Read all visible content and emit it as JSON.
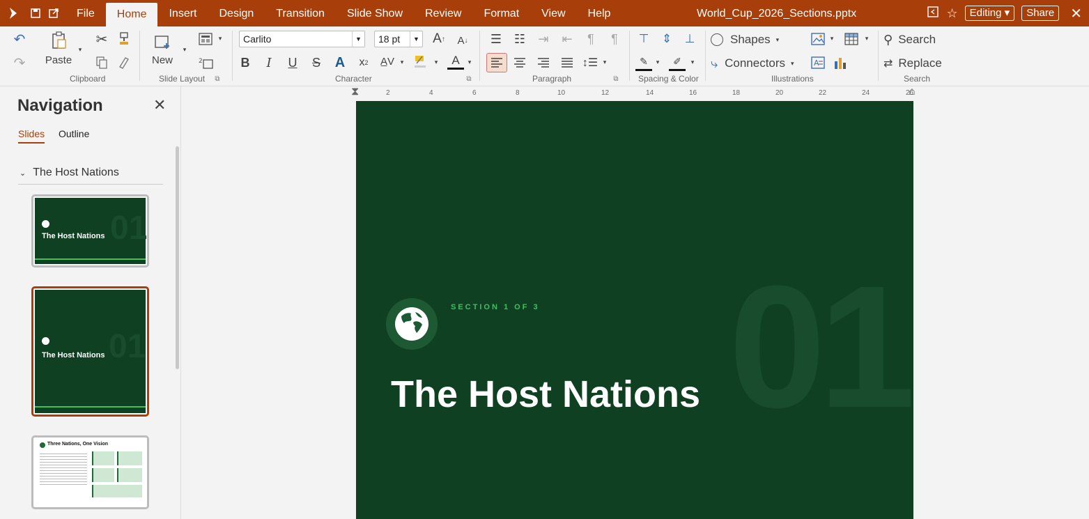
{
  "titlebar": {
    "menu": [
      "File",
      "Home",
      "Insert",
      "Design",
      "Transition",
      "Slide Show",
      "Review",
      "Format",
      "View",
      "Help"
    ],
    "doc_title": "World_Cup_2026_Sections.pptx",
    "editing_label": "Editing",
    "share_label": "Share"
  },
  "ribbon": {
    "paste_label": "Paste",
    "new_label": "New",
    "font_name": "Carlito",
    "font_size": "18 pt",
    "shapes_label": "Shapes",
    "connectors_label": "Connectors",
    "search_label": "Search",
    "replace_label": "Replace",
    "groups": {
      "clipboard": "Clipboard",
      "slide_layout": "Slide Layout",
      "character": "Character",
      "paragraph": "Paragraph",
      "spacing": "Spacing & Color",
      "illustrations": "Illustrations",
      "search": "Search"
    }
  },
  "nav": {
    "title": "Navigation",
    "tabs": [
      "Slides",
      "Outline"
    ],
    "section": "The Host Nations",
    "thumbs": [
      {
        "title": "The Host Nations"
      },
      {
        "title": "The Host Nations"
      },
      {
        "title": "Three Nations, One Vision"
      }
    ]
  },
  "ruler": [
    "2",
    "4",
    "6",
    "8",
    "10",
    "12",
    "14",
    "16",
    "18",
    "20",
    "22",
    "24",
    "26"
  ],
  "slide": {
    "section_label": "SECTION 1 OF 3",
    "number": "01",
    "title": "The Host Nations"
  },
  "colors": {
    "accent": "#a83f0a",
    "slide_bg": "#0f4021",
    "section_green": "#3fbf5f"
  }
}
